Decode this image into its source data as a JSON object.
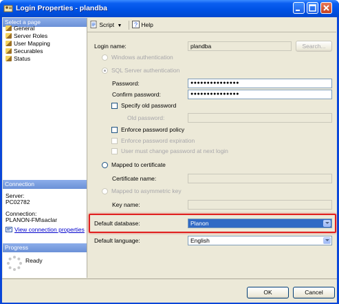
{
  "window": {
    "title": "Login Properties - plandba"
  },
  "left_panel": {
    "select_page_header": "Select a page",
    "pages": [
      "General",
      "Server Roles",
      "User Mapping",
      "Securables",
      "Status"
    ],
    "connection_header": "Connection",
    "server_label": "Server:",
    "server_value": "PC02782",
    "connection_label": "Connection:",
    "connection_value": "PLANON-FM\\saclar",
    "view_connection_link": "View connection properties",
    "progress_header": "Progress",
    "progress_status": "Ready"
  },
  "toolbar": {
    "script_label": "Script",
    "help_label": "Help"
  },
  "form": {
    "login_name_label": "Login name:",
    "login_name_value": "plandba",
    "search_button": "Search...",
    "windows_auth_label": "Windows authentication",
    "sql_auth_label": "SQL Server authentication",
    "password_label": "Password:",
    "password_value": "●●●●●●●●●●●●●●●",
    "confirm_password_label": "Confirm password:",
    "confirm_password_value": "●●●●●●●●●●●●●●●",
    "specify_old_password_label": "Specify old password",
    "old_password_label": "Old password:",
    "enforce_policy_label": "Enforce password policy",
    "enforce_expiration_label": "Enforce password expiration",
    "must_change_label": "User must change password at next login",
    "mapped_certificate_label": "Mapped to certificate",
    "certificate_name_label": "Certificate name:",
    "mapped_asymmetric_label": "Mapped to asymmetric key",
    "key_name_label": "Key name:",
    "default_database_label": "Default database:",
    "default_database_value": "Planon",
    "default_language_label": "Default language:",
    "default_language_value": "English"
  },
  "footer": {
    "ok_label": "OK",
    "cancel_label": "Cancel"
  },
  "colors": {
    "highlight": "#e02020",
    "title_bar": "#0052e6",
    "selection": "#316ac5"
  }
}
